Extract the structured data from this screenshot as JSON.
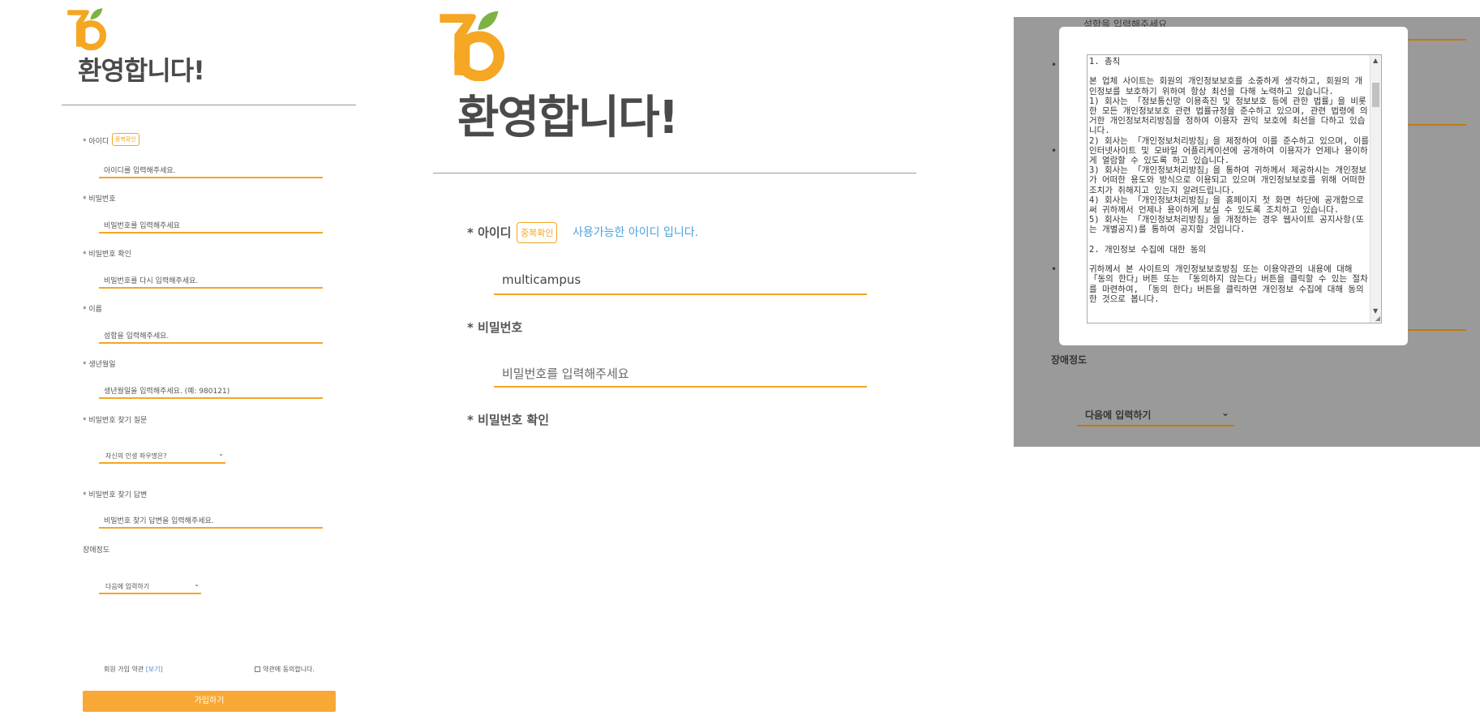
{
  "colors": {
    "accent": "#f5a623",
    "link": "#4aa3df",
    "overlay": "#9a9a9a"
  },
  "logo": {
    "icon": "orange-leaf-logo-icon"
  },
  "p1": {
    "welcome": "환영합니다!",
    "id_label": "* 아이디",
    "dup_check": "중복확인",
    "id_placeholder": "아이디를 입력해주세요.",
    "pw_label": "* 비밀번호",
    "pw_placeholder": "비밀번호를 입력해주세요",
    "pw_confirm_label": "* 비밀번호 확인",
    "pw_confirm_placeholder": "비밀번호를 다시 입력해주세요.",
    "name_label": "* 이름",
    "name_placeholder": "성함을 입력해주세요.",
    "birth_label": "* 생년월일",
    "birth_placeholder": "생년월일을 입력해주세요. (예: 980121)",
    "question_label": "* 비밀번호 찾기 질문",
    "question_value": "자신의 인생 좌우명은?",
    "answer_label": "* 비밀번호 찾기 답변",
    "answer_placeholder": "비밀번호 찾기 답변을 입력해주세요.",
    "disability_label": "장애정도",
    "disability_value": "다음에 입력하기",
    "terms_text": "회원 가입 약관",
    "terms_view": "[보기]",
    "agree_text": "약관에 동의합니다.",
    "join_button": "가입하기"
  },
  "p2": {
    "welcome": "환영합니다!",
    "id_label": "* 아이디",
    "dup_check": "중복확인",
    "available_msg": "사용가능한 아이디 입니다.",
    "id_value": "multicampus",
    "pw_label": "* 비밀번호",
    "pw_placeholder": "비밀번호를 입력해주세요",
    "pw_confirm_label": "* 비밀번호 확인"
  },
  "p3": {
    "bg_top_text": "성함을 입력해주세요",
    "bullet": "•",
    "disability_label": "장애정도",
    "disability_value": "다음에 입력하기",
    "terms_content": "1. 총칙\n\n본 업체 사이트는 회원의 개인정보보호를 소중하게 생각하고, 회원의 개인정보를 보호하기 위하여 항상 최선을 다해 노력하고 있습니다.\n1) 회사는 「정보통신망 이용촉진 및 정보보호 등에 관한 법률」을 비롯한 모든 개인정보보호 관련 법률규정을 준수하고 있으며, 관련 법령에 의거한 개인정보처리방침을 정하여 이용자 권익 보호에 최선을 다하고 있습니다.\n2) 회사는 「개인정보처리방침」을 제정하여 이를 준수하고 있으며, 이를 인터넷사이트 및 모바일 어플리케이션에 공개하여 이용자가 언제나 용이하게 열람할 수 있도록 하고 있습니다.\n3) 회사는 「개인정보처리방침」을 통하여 귀하께서 제공하시는 개인정보가 어떠한 용도와 방식으로 이용되고 있으며 개인정보보호를 위해 어떠한 조치가 취해지고 있는지 알려드립니다.\n4) 회사는 「개인정보처리방침」을 홈페이지 첫 화면 하단에 공개함으로써 귀하께서 언제나 용이하게 보실 수 있도록 조치하고 있습니다.\n5) 회사는 「개인정보처리방침」을 개정하는 경우 웹사이트 공지사항(또는 개별공지)를 통하여 공지할 것입니다.\n\n2. 개인정보 수집에 대한 동의\n\n귀하께서 본 사이트의 개인정보보호방침 또는 이용약관의 내용에 대해 「동의 한다」버튼 또는 「동의하지 않는다」버튼을 클릭할 수 있는 절차를 마련하여, 「동의 한다」버튼을 클릭하면 개인정보 수집에 대해 동의한 것으로 봅니다."
  }
}
